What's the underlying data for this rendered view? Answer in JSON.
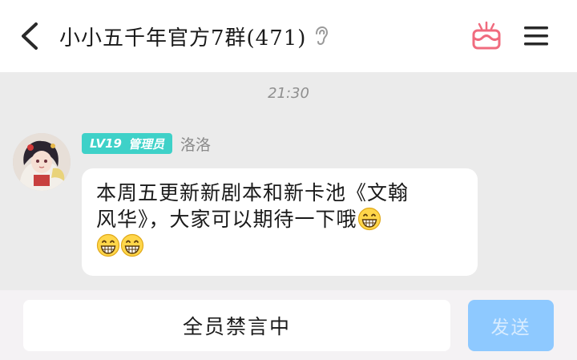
{
  "header": {
    "title": "小小五千年官方7群(471)",
    "back_icon": "back-arrow-icon",
    "ear_icon": "ear-icon",
    "cake_icon": "cake-icon",
    "menu_icon": "hamburger-menu-icon",
    "accent_color": "#f06b7e"
  },
  "chat": {
    "timestamp": "21:30",
    "message": {
      "badge_level": "LV19",
      "badge_role": "管理员",
      "sender": "洛洛",
      "text_line1": "本周五更新新剧本和新卡池《文翰",
      "text_line2": "风华》，大家可以期待一下哦",
      "emoji": "grinning-face-emoji",
      "badge_color": "#3ed1c8"
    }
  },
  "bottom": {
    "input_text": "全员禁言中",
    "send_label": "发送",
    "send_color": "#8ec9ff"
  }
}
